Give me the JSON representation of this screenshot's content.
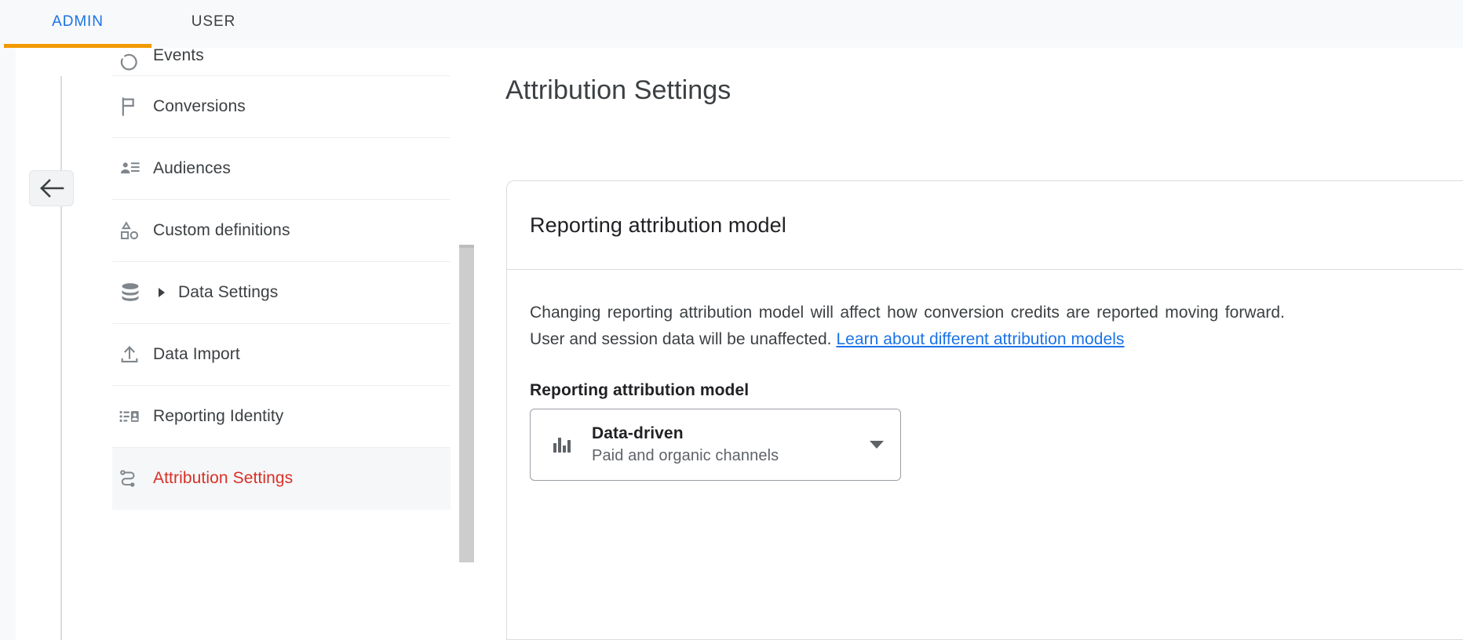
{
  "tabs": [
    {
      "id": "admin",
      "label": "ADMIN",
      "active": true,
      "color": "#1a73e8"
    },
    {
      "id": "user",
      "label": "USER",
      "active": false,
      "color": "#3c4043"
    }
  ],
  "tab_indicator_color": "#f29900",
  "back_button": {
    "icon": "arrow-left-icon"
  },
  "sidebar": {
    "items": [
      {
        "id": "events",
        "label": "Events",
        "icon": "events-icon",
        "selected": false,
        "partial": true,
        "expandable": false
      },
      {
        "id": "conversions",
        "label": "Conversions",
        "icon": "flag-icon",
        "selected": false,
        "partial": false,
        "expandable": false
      },
      {
        "id": "audiences",
        "label": "Audiences",
        "icon": "audiences-icon",
        "selected": false,
        "partial": false,
        "expandable": false
      },
      {
        "id": "custom-definitions",
        "label": "Custom definitions",
        "icon": "shapes-icon",
        "selected": false,
        "partial": false,
        "expandable": false
      },
      {
        "id": "data-settings",
        "label": "Data Settings",
        "icon": "database-icon",
        "selected": false,
        "partial": false,
        "expandable": true
      },
      {
        "id": "data-import",
        "label": "Data Import",
        "icon": "upload-icon",
        "selected": false,
        "partial": false,
        "expandable": false
      },
      {
        "id": "reporting-identity",
        "label": "Reporting Identity",
        "icon": "identity-card-icon",
        "selected": false,
        "partial": false,
        "expandable": false
      },
      {
        "id": "attribution-settings",
        "label": "Attribution Settings",
        "icon": "attribution-path-icon",
        "selected": true,
        "partial": false,
        "expandable": false
      }
    ],
    "selected_color": "#d93025",
    "selected_background": "#f5f7f9",
    "scrollbar": {
      "thumb_color": "#cdcdcd"
    }
  },
  "main": {
    "page_title": "Attribution Settings",
    "card": {
      "header_title": "Reporting attribution model",
      "description_part1": "Changing reporting attribution model will affect how conversion credits are reported moving forward. User and session data will be unaffected. ",
      "description_link": "Learn about different attribution models",
      "link_color": "#1a73e8",
      "field_label": "Reporting attribution model",
      "select": {
        "icon": "bar-chart-icon",
        "value_title": "Data-driven",
        "value_subtitle": "Paid and organic channels",
        "arrow_icon": "dropdown-triangle-icon"
      }
    }
  }
}
